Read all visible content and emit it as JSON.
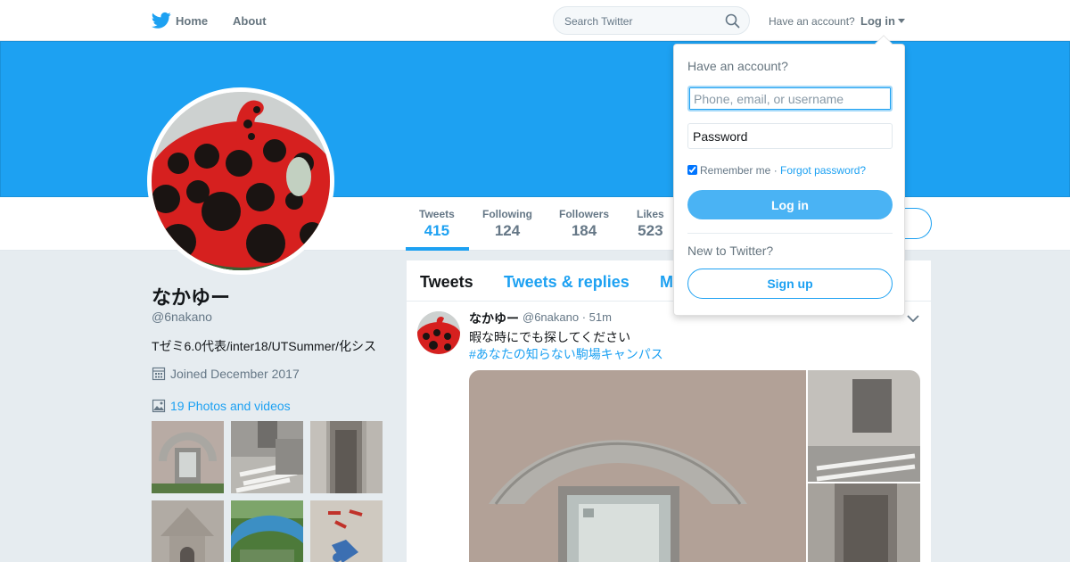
{
  "topnav": {
    "brand_icon": "bird-icon",
    "home_label": "Home",
    "about_label": "About",
    "search_placeholder": "Search Twitter",
    "search_icon": "search-icon",
    "have_account": "Have an account?",
    "login_label": "Log in"
  },
  "profile": {
    "name": "なかゆー",
    "handle": "@6nakano",
    "bio": "Tゼミ6.0代表/inter18/UTSummer/化シス",
    "joined": "Joined December 2017",
    "photos_link": "19 Photos and videos"
  },
  "stats": [
    {
      "label": "Tweets",
      "value": "415"
    },
    {
      "label": "Following",
      "value": "124"
    },
    {
      "label": "Followers",
      "value": "184"
    },
    {
      "label": "Likes",
      "value": "523"
    }
  ],
  "timeline": {
    "tabs": [
      "Tweets",
      "Tweets & replies",
      "M"
    ]
  },
  "tweet": {
    "name": "なかゆー",
    "meta": "@6nakano · 51m",
    "text": "暇な時にでも探してください",
    "hashtag": "#あなたの知らない駒場キャンパス"
  },
  "login_dropdown": {
    "title": "Have an account?",
    "username_placeholder": "Phone, email, or username",
    "password_placeholder": "Password",
    "remember_label": "Remember me",
    "separator": "·",
    "forgot_label": "Forgot password?",
    "login_button": "Log in",
    "new_label": "New to Twitter?",
    "signup_button": "Sign up"
  },
  "colors": {
    "brand_blue": "#1da1f2",
    "banner": "#1da1f2",
    "login_button": "#4ab3f4"
  }
}
